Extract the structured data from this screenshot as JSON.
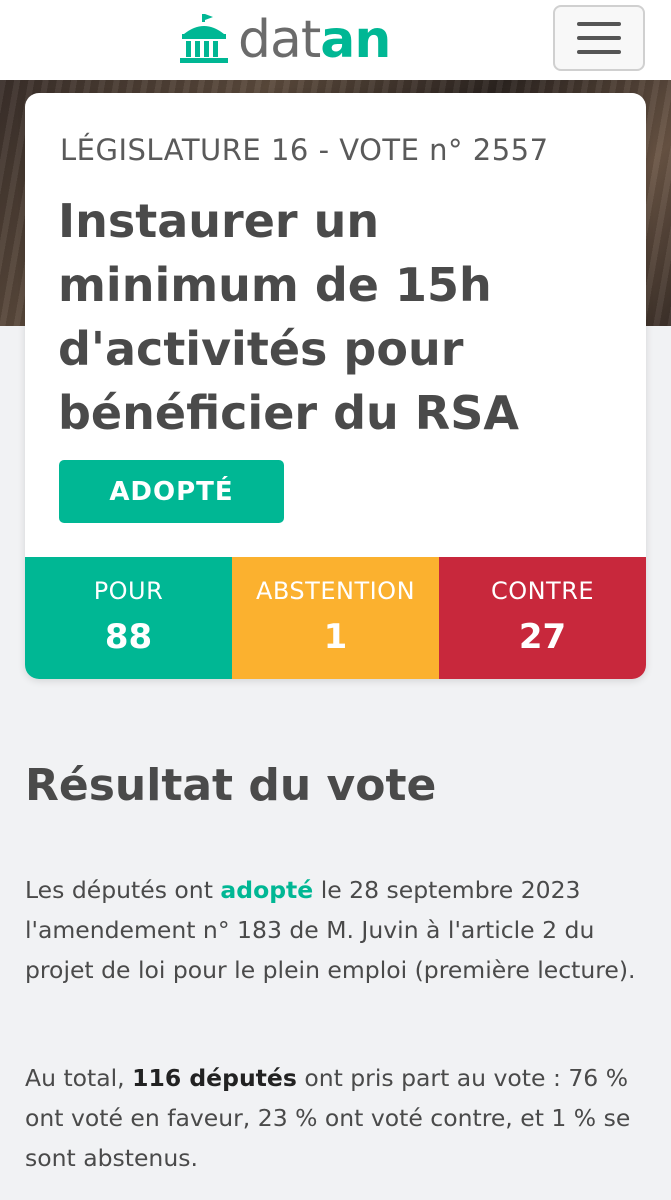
{
  "header": {
    "logo_dat": "dat",
    "logo_an": "an",
    "menu_icon": "hamburger-icon"
  },
  "vote": {
    "legislature": "LÉGISLATURE 16 - VOTE n° 2557",
    "title": "Instaurer un minimum de 15h d'activités pour bénéficier du RSA",
    "status": "ADOPTÉ",
    "pour": {
      "label": "POUR",
      "count": "88"
    },
    "abstention": {
      "label": "ABSTENTION",
      "count": "1"
    },
    "contre": {
      "label": "CONTRE",
      "count": "27"
    }
  },
  "colors": {
    "accent": "#00b794",
    "pour": "#00b794",
    "abstention": "#fbb12f",
    "contre": "#c8283c"
  },
  "result": {
    "heading": "Résultat du vote",
    "p1_prefix": "Les députés ont ",
    "p1_highlight": "adopté",
    "p1_rest": " le 28 septembre 2023 l'amendement n° 183 de M. Juvin à l'article 2 du projet de loi pour le plein emploi (première lecture).",
    "p2_prefix": "Au total, ",
    "p2_bold": "116 députés",
    "p2_rest": " ont pris part au vote : 76 % ont voté en faveur, 23 % ont voté contre, et 1 % se sont abstenus."
  }
}
